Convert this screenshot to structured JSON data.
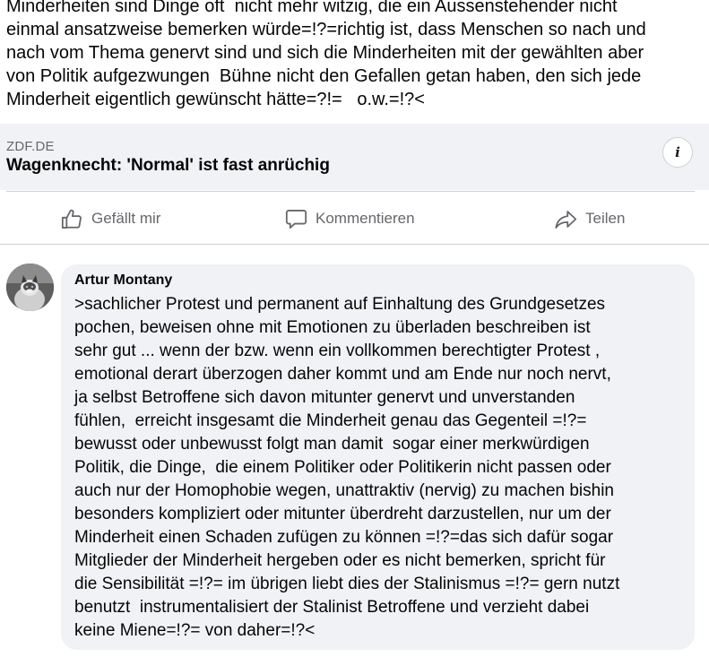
{
  "post": {
    "text_lines": [
      "Minderheiten sind Dinge oft  nicht mehr witzig, die ein Aussenstehender nicht",
      "einmal ansatzweise bemerken würde=!?=richtig ist, dass Menschen so nach und",
      "nach vom Thema genervt sind und sich die Minderheiten mit der gewählten aber",
      "von Politik aufgezwungen  Bühne nicht den Gefallen getan haben, den sich jede",
      "Minderheit eigentlich gewünscht hätte=?!=   o.w.=!?<"
    ]
  },
  "link_preview": {
    "domain": "ZDF.DE",
    "title": "Wagenknecht: 'Normal' ist fast anrüchig",
    "info_icon": "i"
  },
  "actions": {
    "like_label": "Gefällt mir",
    "comment_label": "Kommentieren",
    "share_label": "Teilen"
  },
  "comment": {
    "author": "Artur Montany",
    "text_lines": [
      ">sachlicher Protest und permanent auf Einhaltung des Grundgesetzes",
      "pochen, beweisen ohne mit Emotionen zu überladen beschreiben ist",
      "sehr gut ... wenn der bzw. wenn ein vollkommen berechtigter Protest ,",
      "emotional derart überzogen daher kommt und am Ende nur noch nervt,",
      "ja selbst Betroffene sich davon mitunter genervt und unverstanden",
      "fühlen,  erreicht insgesamt die Minderheit genau das Gegenteil =!?=",
      "bewusst oder unbewusst folgt man damit  sogar einer merkwürdigen",
      "Politik, die Dinge,  die einem Politiker oder Politikerin nicht passen oder",
      "auch nur der Homophobie wegen, unattraktiv (nervig) zu machen bishin",
      "besonders kompliziert oder mitunter überdreht darzustellen, nur um der",
      "Minderheit einen Schaden zufügen zu können =!?=das sich dafür sogar",
      "Mitglieder der Minderheit hergeben oder es nicht bemerken, spricht für",
      "die Sensibilität =!?= im übrigen liebt dies der Stalinismus =!?= gern nutzt",
      "benutzt  instrumentalisiert der Stalinist Betroffene und verzieht dabei",
      "keine Miene=!?= von daher=!?<"
    ]
  },
  "colors": {
    "text": "#050505",
    "secondary_text": "#65676b",
    "card_background": "#f0f2f5",
    "divider": "#ced0d4"
  },
  "icons": {
    "like": "thumbs-up-icon",
    "comment": "speech-bubble-icon",
    "share": "share-arrow-icon",
    "info": "info-icon"
  }
}
